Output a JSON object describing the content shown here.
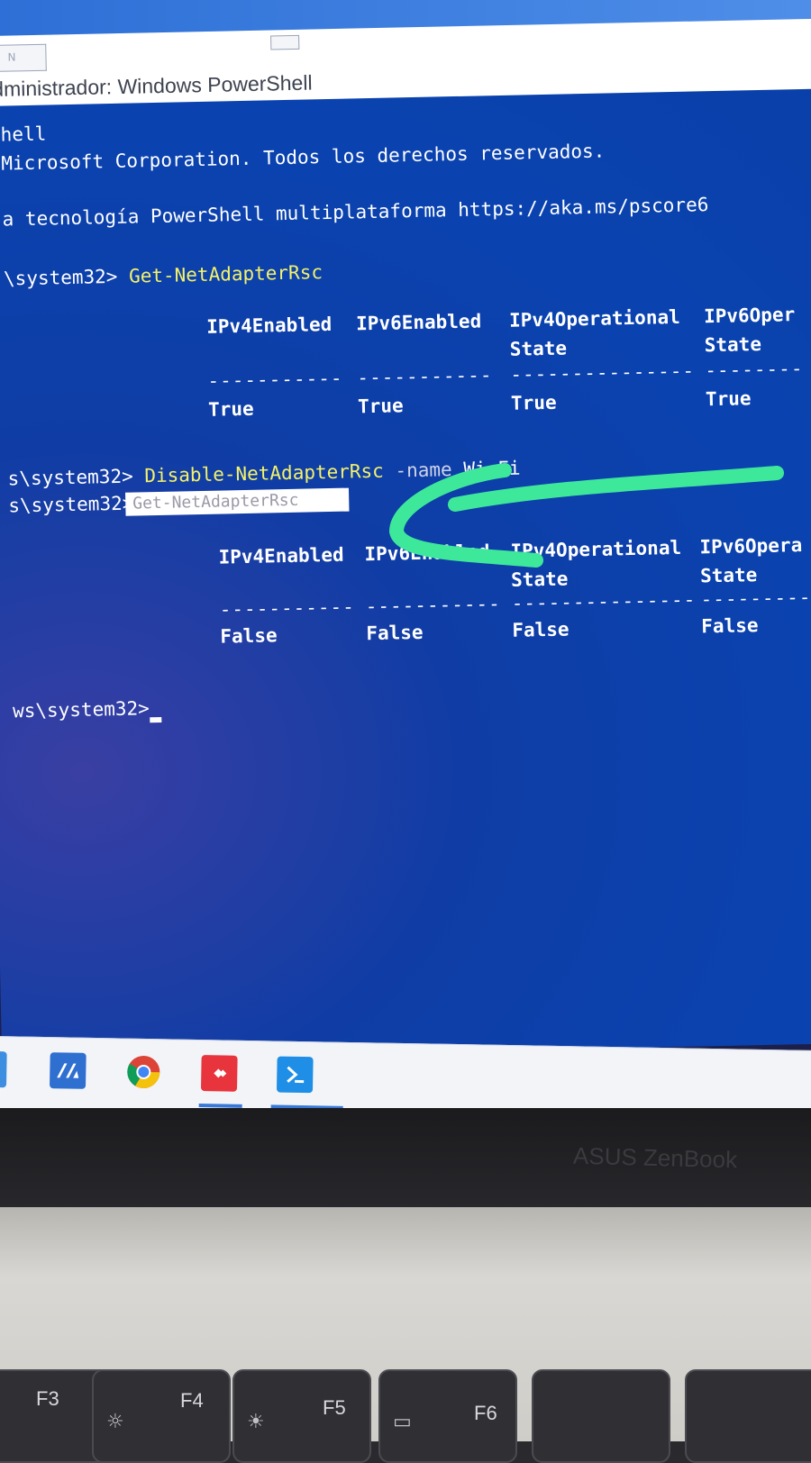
{
  "window": {
    "title": "dministrador: Windows PowerShell",
    "tab_fragment": "N",
    "brand_text": "ASUS ZenBook"
  },
  "console": {
    "intro_lines": [
      "hell",
      "Microsoft Corporation. Todos los derechos reservados.",
      "a tecnología PowerShell multiplataforma https://aka.ms/pscore6"
    ],
    "prompt1": "\\system32> ",
    "cmd1": "Get-NetAdapterRsc",
    "table1": {
      "headers": [
        "IPv4Enabled",
        "IPv6Enabled",
        "IPv4Operational",
        "IPv6Oper"
      ],
      "headers_line2": [
        "",
        "",
        "State",
        "State"
      ],
      "dashes": [
        "-----------",
        "-----------",
        "---------------",
        "--------"
      ],
      "values": [
        "True",
        "True",
        "True",
        "True"
      ]
    },
    "prompt2": "s\\system32> ",
    "cmd2": "Disable-NetAdapterRsc",
    "cmd2_param": " -name ",
    "cmd2_value": "Wi-Fi",
    "prompt3": "s\\system32>",
    "suggestion": "Get-NetAdapterRsc",
    "table2": {
      "headers": [
        "IPv4Enabled",
        "IPv6Enabled",
        "IPv4Operational",
        "IPv6Opera"
      ],
      "headers_line2": [
        "",
        "",
        "State",
        "State"
      ],
      "dashes": [
        "-----------",
        "-----------",
        "---------------",
        "---------"
      ],
      "values": [
        "False",
        "False",
        "False",
        "False"
      ]
    },
    "prompt4": "ws\\system32> "
  },
  "taskbar": {
    "icons": [
      "file-explorer-icon",
      "app-mm-icon",
      "chrome-icon",
      "anydesk-icon",
      "powershell-icon"
    ]
  },
  "keyboard": {
    "keys": [
      {
        "label": "F3",
        "icon": ""
      },
      {
        "label": "F4",
        "icon": "brightness-down-icon"
      },
      {
        "label": "F5",
        "icon": "brightness-up-icon"
      },
      {
        "label": "F6",
        "icon": "display-icon"
      }
    ]
  },
  "colors": {
    "console_bg": "#0a43b0",
    "command": "#f4f26a",
    "annotation": "#3ee89a"
  }
}
